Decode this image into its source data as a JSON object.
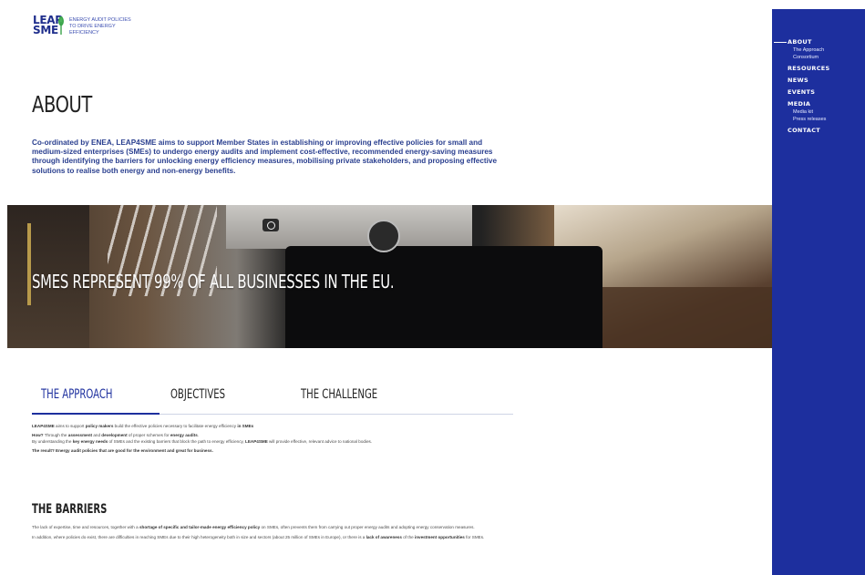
{
  "logo": {
    "line1": "LEAP",
    "line2": "SME",
    "tagline1": "ENERGY AUDIT POLICIES",
    "tagline2": "TO DRIVE ENERGY",
    "tagline3": "EFFICIENCY"
  },
  "nav": {
    "items": [
      {
        "label": "ABOUT",
        "children": [
          "The Approach",
          "Consortium"
        ]
      },
      {
        "label": "RESOURCES"
      },
      {
        "label": "NEWS"
      },
      {
        "label": "EVENTS"
      },
      {
        "label": "MEDIA",
        "children": [
          "Media kit",
          "Press releases"
        ]
      },
      {
        "label": "CONTACT"
      }
    ]
  },
  "page": {
    "title": "ABOUT",
    "intro": "Co-ordinated by ENEA, LEAP4SME aims to support Member States in establishing or improving effective policies for small and medium-sized enterprises (SMEs) to undergo energy audits and implement cost-effective, recommended energy-saving measures through identifying the barriers for unlocking energy efficiency measures, mobilising private stakeholders, and proposing effective solutions to realise both energy and non-energy benefits."
  },
  "hero": {
    "statement": "SMES REPRESENT 99% OF ALL BUSINESSES IN THE EU."
  },
  "tabs": [
    "THE APPROACH",
    "OBJECTIVES",
    "THE CHALLENGE"
  ],
  "approach": {
    "p1_a": "LEAP4SME",
    "p1_b": " aims to support ",
    "p1_c": "policy makers",
    "p1_d": " build the effective policies necessary to facilitate energy efficiency ",
    "p1_e": "in SMEs",
    "p2_a": "How?",
    "p2_b": " Through the ",
    "p2_c": "assessment",
    "p2_d": " and ",
    "p2_e": "development",
    "p2_f": " of proper schemes for ",
    "p2_g": "energy audits",
    "p2_h": ".",
    "p3_a": "By understanding the ",
    "p3_b": "key energy needs",
    "p3_c": " of SMEs and the existing barriers that block the path to energy efficiency, ",
    "p3_d": "LEAP4SME",
    "p3_e": " will provide effective, relevant advice to national bodies.",
    "p4": "The result? Energy audit policies that are good for the environment and great for business."
  },
  "barriers": {
    "title": "THE BARRIERS",
    "p1_a": "The lack of expertise, time and resources, together with a ",
    "p1_b": "shortage of specific and tailor-made energy efficiency policy",
    "p1_c": " on SMEs, often prevents them from carrying out proper energy audits and adopting energy conservation measures.",
    "p2_a": "In addition, where policies do exist, there are difficulties in reaching SMEs due to their high heterogeneity both in size and sectors (about 25 million of SMEs in Europe), or there is a ",
    "p2_b": "lack of awareness",
    "p2_c": " of the ",
    "p2_d": "investment opportunities",
    "p2_e": " for SMEs."
  }
}
